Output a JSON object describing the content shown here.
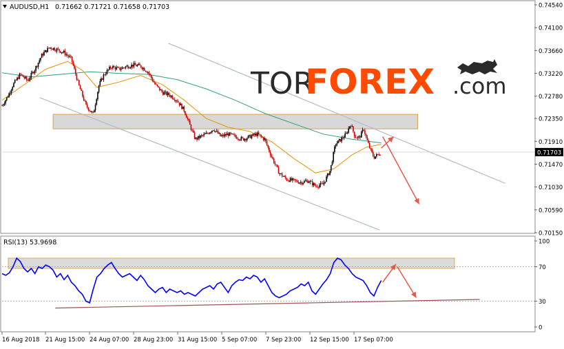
{
  "header": {
    "symbol": "AUDUSD,H1",
    "ohlc": "0.71662 0.71721 0.71658 0.71703"
  },
  "logo": {
    "text_tor": "TOR",
    "text_forex": "FOREX",
    "text_com": ".com"
  },
  "rsi_panel": {
    "label": "RSI(13) 53.9698"
  },
  "colors": {
    "bull": "#000000",
    "bear": "#cc0000",
    "ma_fast": "#e69500",
    "ma_slow": "#2e9e80",
    "channel": "#b0bcc8",
    "zone_fill": "#d8d8d8",
    "zone_border": "#e0a040",
    "arrow": "#e8584a",
    "rsi_line": "#0000ff",
    "support_line": "#a05050",
    "logo_dark": "#2a2a2a",
    "logo_orange": "#ff4a00"
  },
  "chart_data": [
    {
      "type": "candlestick",
      "symbol": "AUDUSD",
      "timeframe": "H1",
      "last_price": "0.71703",
      "ylim": [
        0.7015,
        0.7454
      ],
      "y_ticks": [
        "0.74540",
        "0.74100",
        "0.73660",
        "0.73220",
        "0.72780",
        "0.72350",
        "0.71910",
        "0.71470",
        "0.71030",
        "0.70590",
        "0.70150"
      ],
      "x_ticks": [
        "16 Aug 2018",
        "21 Aug 15:00",
        "24 Aug 07:00",
        "28 Aug 23:00",
        "31 Aug 15:00",
        "5 Sep 07:00",
        "7 Sep 23:00",
        "12 Sep 15:00",
        "17 Sep 07:00"
      ],
      "price_path": [
        [
          0,
          0.726
        ],
        [
          8,
          0.7278
        ],
        [
          15,
          0.73
        ],
        [
          25,
          0.732
        ],
        [
          35,
          0.7308
        ],
        [
          45,
          0.733
        ],
        [
          55,
          0.7358
        ],
        [
          65,
          0.7372
        ],
        [
          75,
          0.7368
        ],
        [
          85,
          0.7362
        ],
        [
          95,
          0.735
        ],
        [
          105,
          0.73
        ],
        [
          115,
          0.726
        ],
        [
          125,
          0.7243
        ],
        [
          133,
          0.73
        ],
        [
          140,
          0.732
        ],
        [
          150,
          0.7335
        ],
        [
          160,
          0.733
        ],
        [
          170,
          0.7335
        ],
        [
          180,
          0.7338
        ],
        [
          190,
          0.7336
        ],
        [
          200,
          0.7325
        ],
        [
          210,
          0.73
        ],
        [
          220,
          0.7285
        ],
        [
          230,
          0.728
        ],
        [
          240,
          0.727
        ],
        [
          250,
          0.725
        ],
        [
          258,
          0.722
        ],
        [
          265,
          0.7195
        ],
        [
          272,
          0.72
        ],
        [
          280,
          0.7205
        ],
        [
          290,
          0.7215
        ],
        [
          300,
          0.72
        ],
        [
          310,
          0.7205
        ],
        [
          320,
          0.72
        ],
        [
          330,
          0.7195
        ],
        [
          340,
          0.72
        ],
        [
          350,
          0.7205
        ],
        [
          360,
          0.7195
        ],
        [
          370,
          0.716
        ],
        [
          380,
          0.713
        ],
        [
          390,
          0.7118
        ],
        [
          400,
          0.7115
        ],
        [
          410,
          0.7112
        ],
        [
          420,
          0.7115
        ],
        [
          430,
          0.7105
        ],
        [
          440,
          0.7108
        ],
        [
          450,
          0.7135
        ],
        [
          457,
          0.7185
        ],
        [
          465,
          0.7195
        ],
        [
          472,
          0.7205
        ],
        [
          478,
          0.7225
        ],
        [
          484,
          0.72
        ],
        [
          490,
          0.7198
        ],
        [
          496,
          0.7215
        ],
        [
          500,
          0.7195
        ],
        [
          505,
          0.7175
        ],
        [
          510,
          0.716
        ],
        [
          515,
          0.7165
        ],
        [
          520,
          0.717
        ]
      ],
      "ma_fast": [
        [
          0,
          0.727
        ],
        [
          30,
          0.73
        ],
        [
          60,
          0.733
        ],
        [
          90,
          0.7345
        ],
        [
          110,
          0.7328
        ],
        [
          130,
          0.7295
        ],
        [
          160,
          0.7305
        ],
        [
          190,
          0.7318
        ],
        [
          220,
          0.73
        ],
        [
          250,
          0.727
        ],
        [
          280,
          0.7235
        ],
        [
          310,
          0.7218
        ],
        [
          340,
          0.721
        ],
        [
          370,
          0.719
        ],
        [
          400,
          0.7158
        ],
        [
          430,
          0.713
        ],
        [
          455,
          0.7138
        ],
        [
          480,
          0.7165
        ],
        [
          500,
          0.718
        ],
        [
          520,
          0.7185
        ]
      ],
      "ma_slow": [
        [
          0,
          0.7323
        ],
        [
          40,
          0.7315
        ],
        [
          80,
          0.732
        ],
        [
          120,
          0.7325
        ],
        [
          160,
          0.7322
        ],
        [
          200,
          0.732
        ],
        [
          240,
          0.731
        ],
        [
          280,
          0.7292
        ],
        [
          320,
          0.727
        ],
        [
          360,
          0.7245
        ],
        [
          400,
          0.7225
        ],
        [
          440,
          0.7205
        ],
        [
          480,
          0.7195
        ],
        [
          520,
          0.7188
        ]
      ],
      "channel_upper": [
        [
          228,
          0.738
        ],
        [
          690,
          0.711
        ]
      ],
      "channel_lower": [
        [
          52,
          0.7275
        ],
        [
          518,
          0.702
        ]
      ],
      "resistance_zone": [
        0.7215,
        0.7243
      ],
      "forecast_arrows": [
        [
          [
            520,
            0.7178
          ],
          [
            537,
            0.72
          ]
        ],
        [
          [
            522,
            0.72
          ],
          [
            572,
            0.707
          ]
        ]
      ]
    },
    {
      "type": "line",
      "name": "RSI(13)",
      "last_value": 53.9698,
      "ylim": [
        0,
        100
      ],
      "y_ticks": [
        "100",
        "70",
        "30",
        "0"
      ],
      "rsi_path": [
        [
          0,
          62
        ],
        [
          5,
          60
        ],
        [
          10,
          63
        ],
        [
          15,
          70
        ],
        [
          20,
          80
        ],
        [
          25,
          76
        ],
        [
          30,
          68
        ],
        [
          35,
          64
        ],
        [
          40,
          68
        ],
        [
          45,
          62
        ],
        [
          50,
          70
        ],
        [
          55,
          68
        ],
        [
          60,
          72
        ],
        [
          65,
          70
        ],
        [
          70,
          66
        ],
        [
          75,
          58
        ],
        [
          80,
          62
        ],
        [
          85,
          55
        ],
        [
          90,
          60
        ],
        [
          95,
          52
        ],
        [
          100,
          48
        ],
        [
          105,
          42
        ],
        [
          110,
          38
        ],
        [
          115,
          30
        ],
        [
          120,
          28
        ],
        [
          125,
          44
        ],
        [
          130,
          58
        ],
        [
          135,
          62
        ],
        [
          140,
          68
        ],
        [
          145,
          72
        ],
        [
          150,
          75
        ],
        [
          155,
          68
        ],
        [
          160,
          62
        ],
        [
          165,
          58
        ],
        [
          170,
          60
        ],
        [
          175,
          62
        ],
        [
          180,
          58
        ],
        [
          185,
          54
        ],
        [
          190,
          60
        ],
        [
          195,
          55
        ],
        [
          200,
          48
        ],
        [
          205,
          44
        ],
        [
          210,
          40
        ],
        [
          215,
          44
        ],
        [
          220,
          46
        ],
        [
          225,
          40
        ],
        [
          230,
          44
        ],
        [
          235,
          42
        ],
        [
          240,
          40
        ],
        [
          245,
          42
        ],
        [
          250,
          38
        ],
        [
          255,
          40
        ],
        [
          260,
          38
        ],
        [
          265,
          36
        ],
        [
          270,
          40
        ],
        [
          275,
          44
        ],
        [
          280,
          46
        ],
        [
          285,
          48
        ],
        [
          290,
          44
        ],
        [
          295,
          50
        ],
        [
          300,
          52
        ],
        [
          305,
          46
        ],
        [
          310,
          40
        ],
        [
          315,
          48
        ],
        [
          320,
          52
        ],
        [
          325,
          55
        ],
        [
          330,
          54
        ],
        [
          335,
          58
        ],
        [
          340,
          56
        ],
        [
          345,
          60
        ],
        [
          350,
          58
        ],
        [
          355,
          52
        ],
        [
          360,
          56
        ],
        [
          365,
          48
        ],
        [
          370,
          40
        ],
        [
          375,
          36
        ],
        [
          380,
          34
        ],
        [
          385,
          36
        ],
        [
          390,
          38
        ],
        [
          395,
          42
        ],
        [
          400,
          44
        ],
        [
          405,
          46
        ],
        [
          410,
          50
        ],
        [
          415,
          48
        ],
        [
          420,
          52
        ],
        [
          425,
          42
        ],
        [
          430,
          38
        ],
        [
          435,
          44
        ],
        [
          440,
          50
        ],
        [
          445,
          55
        ],
        [
          450,
          62
        ],
        [
          455,
          75
        ],
        [
          460,
          80
        ],
        [
          465,
          78
        ],
        [
          470,
          72
        ],
        [
          475,
          68
        ],
        [
          480,
          62
        ],
        [
          485,
          58
        ],
        [
          490,
          56
        ],
        [
          495,
          54
        ],
        [
          500,
          48
        ],
        [
          505,
          40
        ],
        [
          510,
          36
        ],
        [
          515,
          46
        ],
        [
          520,
          54
        ]
      ],
      "overbought_zone": [
        68,
        80
      ],
      "level_lines": [
        70,
        30
      ],
      "support_line": [
        [
          73,
          22
        ],
        [
          655,
          32
        ]
      ],
      "forecast_arrows": [
        [
          [
            522,
            52
          ],
          [
            540,
            73
          ]
        ],
        [
          [
            542,
            70
          ],
          [
            568,
            34
          ]
        ]
      ]
    }
  ]
}
